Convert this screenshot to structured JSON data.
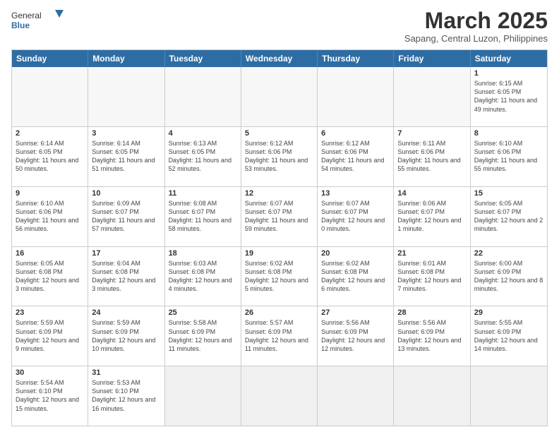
{
  "header": {
    "logo_general": "General",
    "logo_blue": "Blue",
    "month_title": "March 2025",
    "subtitle": "Sapang, Central Luzon, Philippines"
  },
  "weekdays": [
    "Sunday",
    "Monday",
    "Tuesday",
    "Wednesday",
    "Thursday",
    "Friday",
    "Saturday"
  ],
  "rows": [
    [
      {
        "day": "",
        "info": "",
        "empty": true
      },
      {
        "day": "",
        "info": "",
        "empty": true
      },
      {
        "day": "",
        "info": "",
        "empty": true
      },
      {
        "day": "",
        "info": "",
        "empty": true
      },
      {
        "day": "",
        "info": "",
        "empty": true
      },
      {
        "day": "",
        "info": "",
        "empty": true
      },
      {
        "day": "1",
        "info": "Sunrise: 6:15 AM\nSunset: 6:05 PM\nDaylight: 11 hours\nand 49 minutes."
      }
    ],
    [
      {
        "day": "2",
        "info": "Sunrise: 6:14 AM\nSunset: 6:05 PM\nDaylight: 11 hours\nand 50 minutes."
      },
      {
        "day": "3",
        "info": "Sunrise: 6:14 AM\nSunset: 6:05 PM\nDaylight: 11 hours\nand 51 minutes."
      },
      {
        "day": "4",
        "info": "Sunrise: 6:13 AM\nSunset: 6:05 PM\nDaylight: 11 hours\nand 52 minutes."
      },
      {
        "day": "5",
        "info": "Sunrise: 6:12 AM\nSunset: 6:06 PM\nDaylight: 11 hours\nand 53 minutes."
      },
      {
        "day": "6",
        "info": "Sunrise: 6:12 AM\nSunset: 6:06 PM\nDaylight: 11 hours\nand 54 minutes."
      },
      {
        "day": "7",
        "info": "Sunrise: 6:11 AM\nSunset: 6:06 PM\nDaylight: 11 hours\nand 55 minutes."
      },
      {
        "day": "8",
        "info": "Sunrise: 6:10 AM\nSunset: 6:06 PM\nDaylight: 11 hours\nand 55 minutes."
      }
    ],
    [
      {
        "day": "9",
        "info": "Sunrise: 6:10 AM\nSunset: 6:06 PM\nDaylight: 11 hours\nand 56 minutes."
      },
      {
        "day": "10",
        "info": "Sunrise: 6:09 AM\nSunset: 6:07 PM\nDaylight: 11 hours\nand 57 minutes."
      },
      {
        "day": "11",
        "info": "Sunrise: 6:08 AM\nSunset: 6:07 PM\nDaylight: 11 hours\nand 58 minutes."
      },
      {
        "day": "12",
        "info": "Sunrise: 6:07 AM\nSunset: 6:07 PM\nDaylight: 11 hours\nand 59 minutes."
      },
      {
        "day": "13",
        "info": "Sunrise: 6:07 AM\nSunset: 6:07 PM\nDaylight: 12 hours\nand 0 minutes."
      },
      {
        "day": "14",
        "info": "Sunrise: 6:06 AM\nSunset: 6:07 PM\nDaylight: 12 hours\nand 1 minute."
      },
      {
        "day": "15",
        "info": "Sunrise: 6:05 AM\nSunset: 6:07 PM\nDaylight: 12 hours\nand 2 minutes."
      }
    ],
    [
      {
        "day": "16",
        "info": "Sunrise: 6:05 AM\nSunset: 6:08 PM\nDaylight: 12 hours\nand 3 minutes."
      },
      {
        "day": "17",
        "info": "Sunrise: 6:04 AM\nSunset: 6:08 PM\nDaylight: 12 hours\nand 3 minutes."
      },
      {
        "day": "18",
        "info": "Sunrise: 6:03 AM\nSunset: 6:08 PM\nDaylight: 12 hours\nand 4 minutes."
      },
      {
        "day": "19",
        "info": "Sunrise: 6:02 AM\nSunset: 6:08 PM\nDaylight: 12 hours\nand 5 minutes."
      },
      {
        "day": "20",
        "info": "Sunrise: 6:02 AM\nSunset: 6:08 PM\nDaylight: 12 hours\nand 6 minutes."
      },
      {
        "day": "21",
        "info": "Sunrise: 6:01 AM\nSunset: 6:08 PM\nDaylight: 12 hours\nand 7 minutes."
      },
      {
        "day": "22",
        "info": "Sunrise: 6:00 AM\nSunset: 6:09 PM\nDaylight: 12 hours\nand 8 minutes."
      }
    ],
    [
      {
        "day": "23",
        "info": "Sunrise: 5:59 AM\nSunset: 6:09 PM\nDaylight: 12 hours\nand 9 minutes."
      },
      {
        "day": "24",
        "info": "Sunrise: 5:59 AM\nSunset: 6:09 PM\nDaylight: 12 hours\nand 10 minutes."
      },
      {
        "day": "25",
        "info": "Sunrise: 5:58 AM\nSunset: 6:09 PM\nDaylight: 12 hours\nand 11 minutes."
      },
      {
        "day": "26",
        "info": "Sunrise: 5:57 AM\nSunset: 6:09 PM\nDaylight: 12 hours\nand 11 minutes."
      },
      {
        "day": "27",
        "info": "Sunrise: 5:56 AM\nSunset: 6:09 PM\nDaylight: 12 hours\nand 12 minutes."
      },
      {
        "day": "28",
        "info": "Sunrise: 5:56 AM\nSunset: 6:09 PM\nDaylight: 12 hours\nand 13 minutes."
      },
      {
        "day": "29",
        "info": "Sunrise: 5:55 AM\nSunset: 6:09 PM\nDaylight: 12 hours\nand 14 minutes."
      }
    ],
    [
      {
        "day": "30",
        "info": "Sunrise: 5:54 AM\nSunset: 6:10 PM\nDaylight: 12 hours\nand 15 minutes."
      },
      {
        "day": "31",
        "info": "Sunrise: 5:53 AM\nSunset: 6:10 PM\nDaylight: 12 hours\nand 16 minutes."
      },
      {
        "day": "",
        "info": "",
        "empty": true,
        "shaded": true
      },
      {
        "day": "",
        "info": "",
        "empty": true,
        "shaded": true
      },
      {
        "day": "",
        "info": "",
        "empty": true,
        "shaded": true
      },
      {
        "day": "",
        "info": "",
        "empty": true,
        "shaded": true
      },
      {
        "day": "",
        "info": "",
        "empty": true,
        "shaded": true
      }
    ]
  ]
}
